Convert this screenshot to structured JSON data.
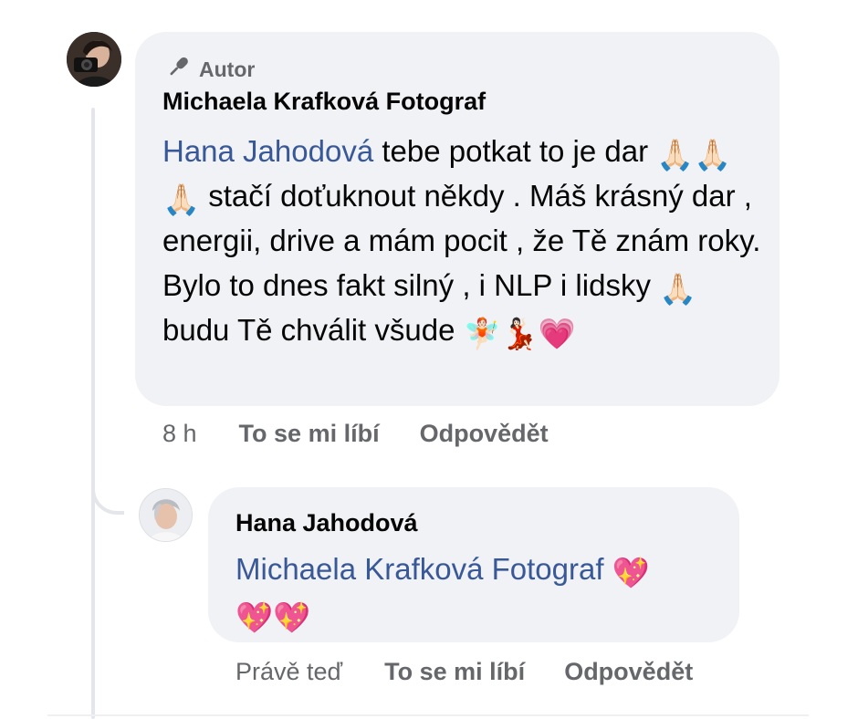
{
  "comment": {
    "badge": {
      "icon": "microphone-icon",
      "label": "Autor"
    },
    "author": "Michaela Krafková Fotograf",
    "mention": "Hana Jahodová",
    "body_before_emojis": " tebe potkat to je dar ",
    "prayer_emoji": "🙏🏻",
    "body_middle": " stačí doťuknout někdy . Máš krásný dar , energii, drive a mám pocit , že Tě znám roky. Bylo to dnes fakt silný , i NLP i lidsky ",
    "body_end": " budu Tě chválit všude ",
    "end_emojis": [
      "🧚🏻",
      "💃🏻",
      "💗"
    ],
    "time": "8 h",
    "like_label": "To se mi líbí",
    "reply_label": "Odpovědět"
  },
  "reply": {
    "author": "Hana Jahodová",
    "mention": "Michaela Krafková Fotograf",
    "emoji": "💖",
    "time": "Právě teď",
    "like_label": "To se mi líbí",
    "reply_label": "Odpovědět"
  },
  "colors": {
    "bubble": "#f0f2f5",
    "mention": "#385898",
    "meta_text": "#65676b"
  }
}
